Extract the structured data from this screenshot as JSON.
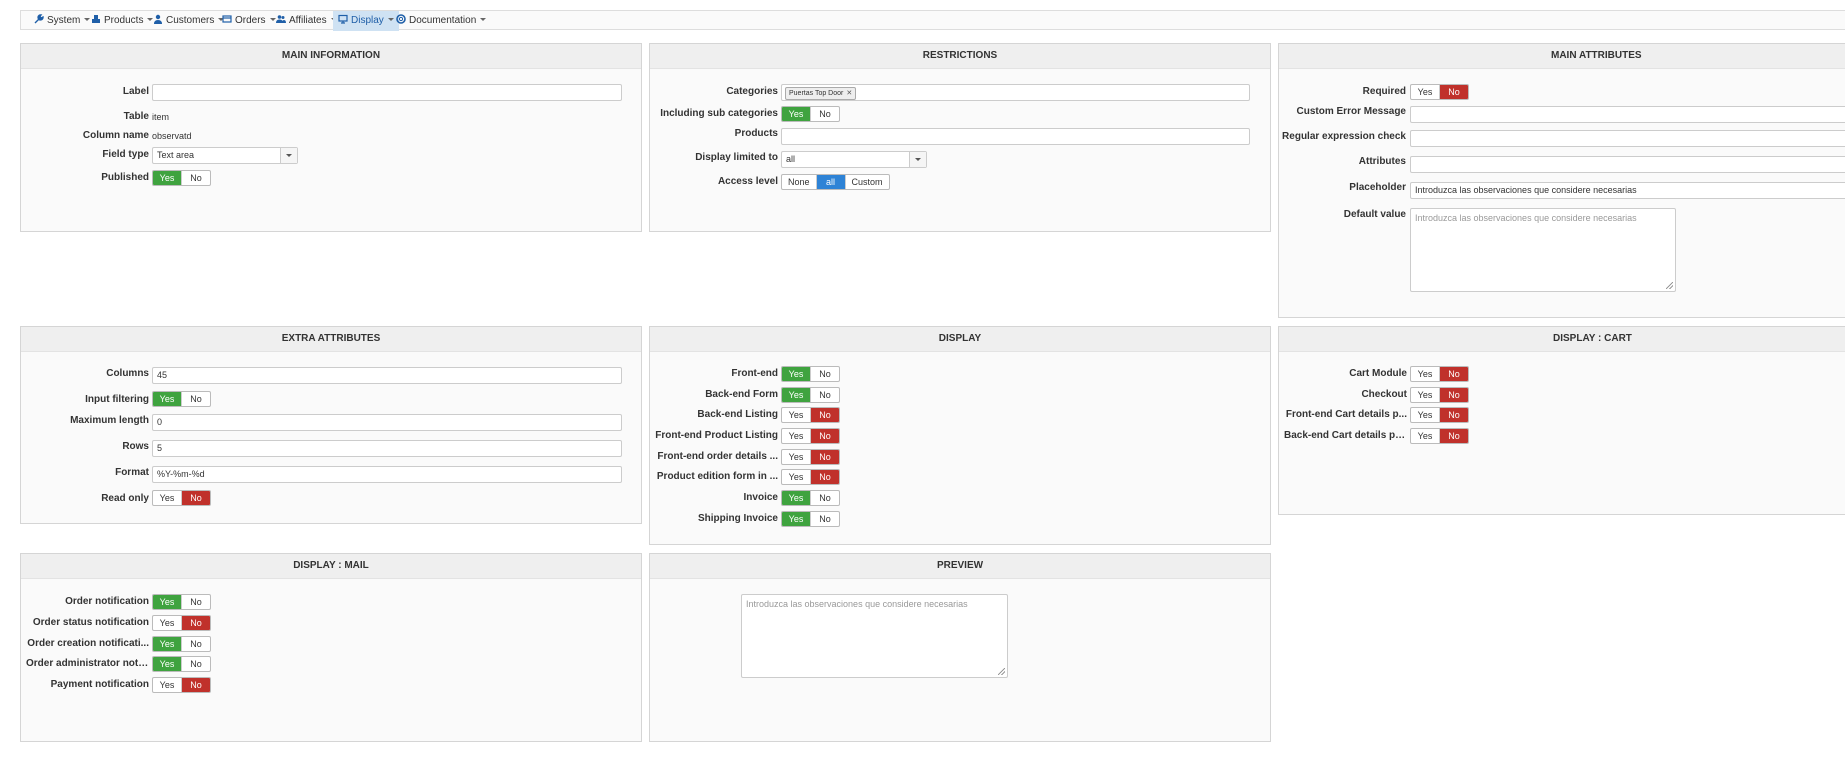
{
  "nav": {
    "items": [
      {
        "label": "System",
        "icon": "wrench-icon"
      },
      {
        "label": "Products",
        "icon": "cubes-icon"
      },
      {
        "label": "Customers",
        "icon": "user-icon"
      },
      {
        "label": "Orders",
        "icon": "orders-icon"
      },
      {
        "label": "Affiliates",
        "icon": "users-icon"
      },
      {
        "label": "Display",
        "icon": "monitor-icon",
        "active": true
      },
      {
        "label": "Documentation",
        "icon": "lifebuoy-icon"
      }
    ]
  },
  "toggle": {
    "yes": "Yes",
    "no": "No"
  },
  "main_information": {
    "title": "MAIN INFORMATION",
    "label_label": "Label",
    "label_value": "",
    "table_label": "Table",
    "table_value": "item",
    "column_label": "Column name",
    "column_value": "observatd",
    "fieldtype_label": "Field type",
    "fieldtype_value": "Text area",
    "published_label": "Published",
    "published": "yes"
  },
  "restrictions": {
    "title": "RESTRICTIONS",
    "categories_label": "Categories",
    "category_tag": "Puertas Top Door",
    "subcat_label": "Including sub categories",
    "subcat": "yes",
    "products_label": "Products",
    "display_limited_label": "Display limited to",
    "display_limited_value": "all",
    "access_label": "Access level",
    "access_options": [
      "None",
      "all",
      "Custom"
    ],
    "access_selected": "all"
  },
  "main_attributes": {
    "title": "MAIN ATTRIBUTES",
    "required_label": "Required",
    "required": "no",
    "custom_error_label": "Custom Error Message",
    "regex_label": "Regular expression check",
    "attributes_label": "Attributes",
    "placeholder_label": "Placeholder",
    "placeholder_value": "Introduzca las observaciones que considere necesarias",
    "default_label": "Default value",
    "default_placeholder": "Introduzca las observaciones que considere necesarias"
  },
  "extra_attributes": {
    "title": "EXTRA ATTRIBUTES",
    "columns_label": "Columns",
    "columns_value": "45",
    "filter_label": "Input filtering",
    "filter": "yes",
    "maxlen_label": "Maximum length",
    "maxlen_value": "0",
    "rows_label": "Rows",
    "rows_value": "5",
    "format_label": "Format",
    "format_value": "%Y-%m-%d",
    "readonly_label": "Read only",
    "readonly": "no"
  },
  "display": {
    "title": "DISPLAY",
    "rows": [
      {
        "label": "Front-end",
        "state": "yes"
      },
      {
        "label": "Back-end Form",
        "state": "yes"
      },
      {
        "label": "Back-end Listing",
        "state": "no"
      },
      {
        "label": "Front-end Product Listing",
        "state": "no"
      },
      {
        "label": "Front-end order details ...",
        "state": "no"
      },
      {
        "label": "Product edition form in ...",
        "state": "no"
      },
      {
        "label": "Invoice",
        "state": "yes"
      },
      {
        "label": "Shipping Invoice",
        "state": "yes"
      }
    ]
  },
  "display_cart": {
    "title": "DISPLAY : CART",
    "rows": [
      {
        "label": "Cart Module",
        "state": "no"
      },
      {
        "label": "Checkout",
        "state": "no"
      },
      {
        "label": "Front-end Cart details p...",
        "state": "no"
      },
      {
        "label": "Back-end Cart details pa...",
        "state": "no"
      }
    ]
  },
  "display_mail": {
    "title": "DISPLAY : MAIL",
    "rows": [
      {
        "label": "Order notification",
        "state": "yes"
      },
      {
        "label": "Order status notification",
        "state": "no"
      },
      {
        "label": "Order creation notificati...",
        "state": "yes"
      },
      {
        "label": "Order administrator noti...",
        "state": "yes"
      },
      {
        "label": "Payment notification",
        "state": "no"
      }
    ]
  },
  "preview": {
    "title": "PREVIEW",
    "textarea_placeholder": "Introduzca las observaciones que considere necesarias"
  },
  "colors": {
    "yes": "#3fa33f",
    "no": "#c0312b",
    "selected": "#2e83d6",
    "nav_active": "#cfe2f3"
  }
}
